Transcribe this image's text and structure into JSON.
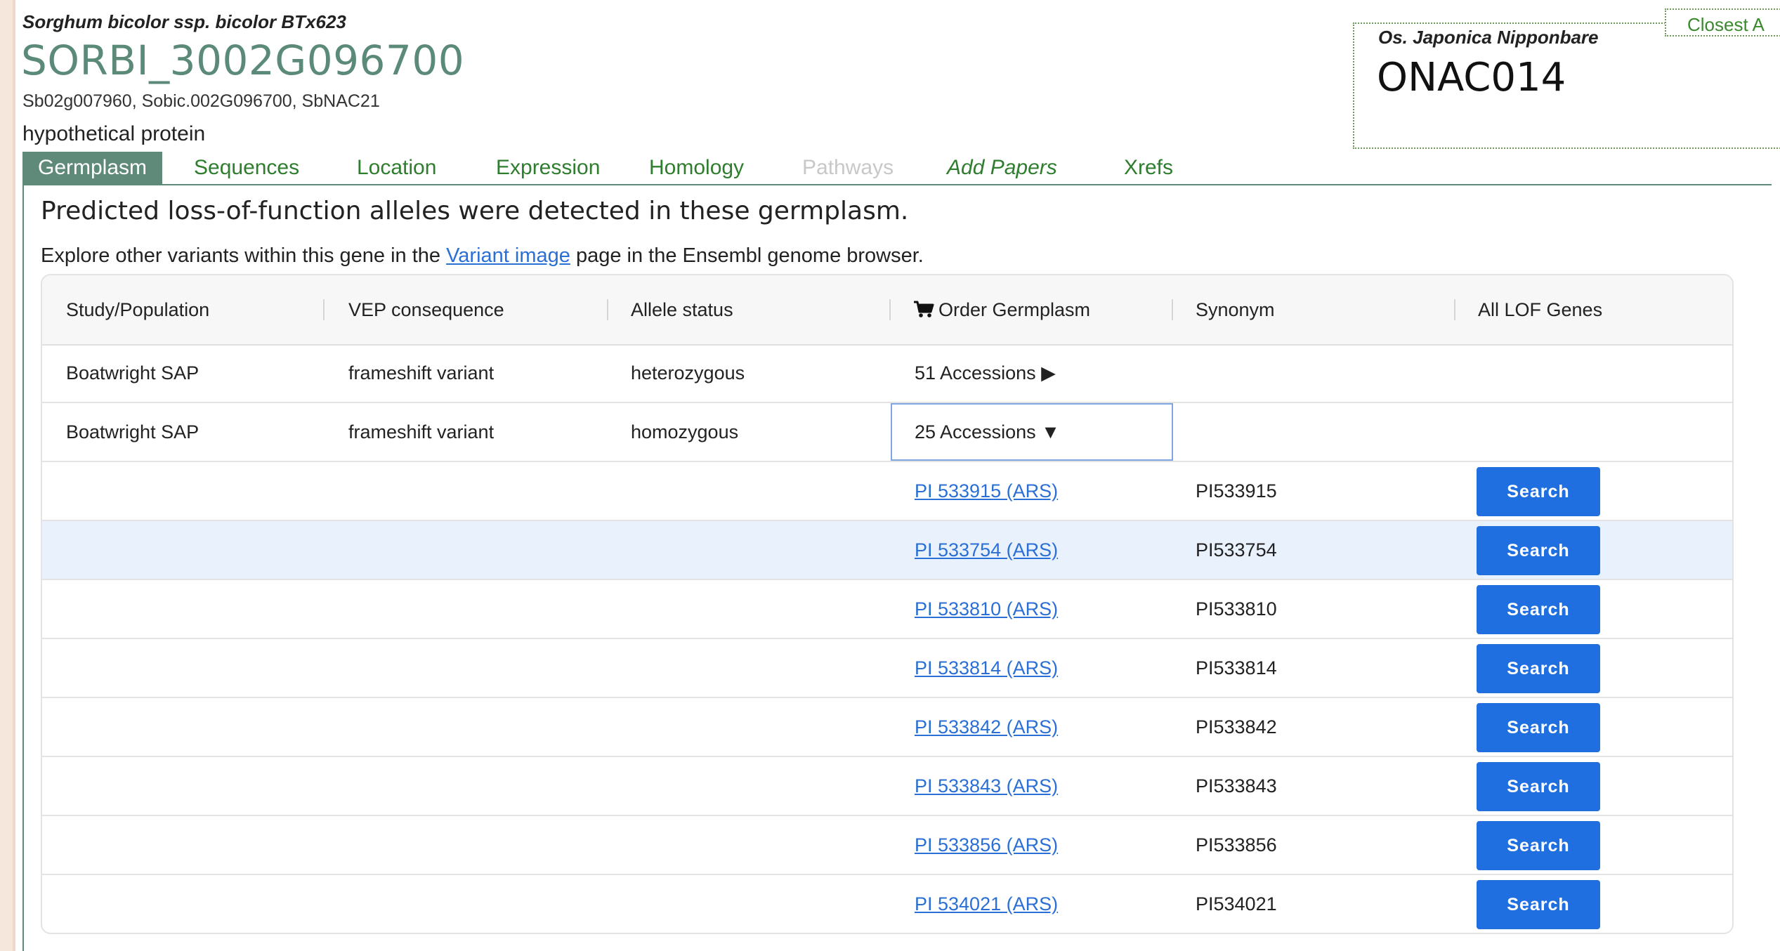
{
  "gene": {
    "species": "Sorghum bicolor ssp. bicolor BTx623",
    "id": "SORBI_3002G096700",
    "synonyms": "Sb02g007960, Sobic.002G096700, SbNAC21",
    "description": "hypothetical protein"
  },
  "closest": {
    "tab_label": "Closest A",
    "species": "Os. Japonica Nipponbare",
    "name": "ONAC014"
  },
  "tabs": [
    {
      "label": "Germplasm",
      "state": "active"
    },
    {
      "label": "Sequences",
      "state": "normal"
    },
    {
      "label": "Location",
      "state": "normal"
    },
    {
      "label": "Expression",
      "state": "normal"
    },
    {
      "label": "Homology",
      "state": "normal"
    },
    {
      "label": "Pathways",
      "state": "disabled"
    },
    {
      "label": "Add Papers",
      "state": "italic"
    },
    {
      "label": "Xrefs",
      "state": "normal"
    }
  ],
  "panel": {
    "heading": "Predicted loss-of-function alleles were detected in these germplasm.",
    "explore_before": "Explore other variants within this gene in the ",
    "explore_link": "Variant image",
    "explore_after": " page in the Ensembl genome browser."
  },
  "table": {
    "headers": [
      "Study/Population",
      "VEP consequence",
      "Allele status",
      "Order Germplasm",
      "Synonym",
      "All LOF Genes"
    ],
    "cart_icon": "shopping-cart-icon",
    "groups": [
      {
        "study": "Boatwright SAP",
        "consequence": "frameshift variant",
        "status": "heterozygous",
        "accessions": "51 Accessions",
        "toggle": "▶"
      },
      {
        "study": "Boatwright SAP",
        "consequence": "frameshift variant",
        "status": "homozygous",
        "accessions": "25 Accessions",
        "toggle": "▼"
      }
    ],
    "accession_rows": [
      {
        "link": "PI 533915 (ARS)",
        "synonym": "PI533915",
        "button": "Search"
      },
      {
        "link": "PI 533754 (ARS)",
        "synonym": "PI533754",
        "button": "Search"
      },
      {
        "link": "PI 533810 (ARS)",
        "synonym": "PI533810",
        "button": "Search"
      },
      {
        "link": "PI 533814 (ARS)",
        "synonym": "PI533814",
        "button": "Search"
      },
      {
        "link": "PI 533842 (ARS)",
        "synonym": "PI533842",
        "button": "Search"
      },
      {
        "link": "PI 533843 (ARS)",
        "synonym": "PI533843",
        "button": "Search"
      },
      {
        "link": "PI 533856 (ARS)",
        "synonym": "PI533856",
        "button": "Search"
      },
      {
        "link": "PI 534021 (ARS)",
        "synonym": "PI534021",
        "button": "Search"
      }
    ]
  },
  "colors": {
    "gene_id": "#5b8a78",
    "tab_active_bg": "#5f8a7a",
    "tab_text": "#2f7d2f",
    "link": "#2a6fd6",
    "button": "#1f6fe0",
    "row_highlight": "#e9f1fd"
  }
}
